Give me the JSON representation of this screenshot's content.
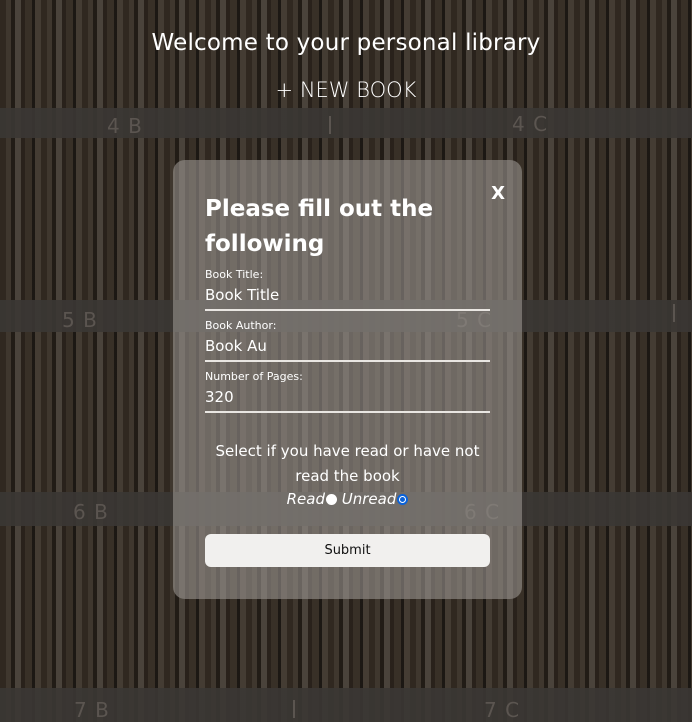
{
  "header": {
    "title": "Welcome to your personal library",
    "new_book_label": "+ NEW BOOK"
  },
  "shelf_labels": [
    "4 B",
    "4 C",
    "5 B",
    "5 C",
    "6 B",
    "6 C",
    "7 B",
    "7 C"
  ],
  "modal": {
    "close_label": "X",
    "title": "Please fill out the following",
    "fields": [
      {
        "label": "Book Title:",
        "value": "Book Title"
      },
      {
        "label": "Book Author:",
        "value": "Book Au"
      },
      {
        "label": "Number of Pages:",
        "value": "320"
      }
    ],
    "read_question": "Select if you have read or have not read the book",
    "radio_read_label": "Read",
    "radio_unread_label": "Unread",
    "selected_option": "Unread",
    "submit_label": "Submit"
  },
  "colors": {
    "radio_accent": "#0a62d9",
    "modal_bg": "rgba(150,146,141,0.62)",
    "submit_bg": "#f1f0ee"
  }
}
